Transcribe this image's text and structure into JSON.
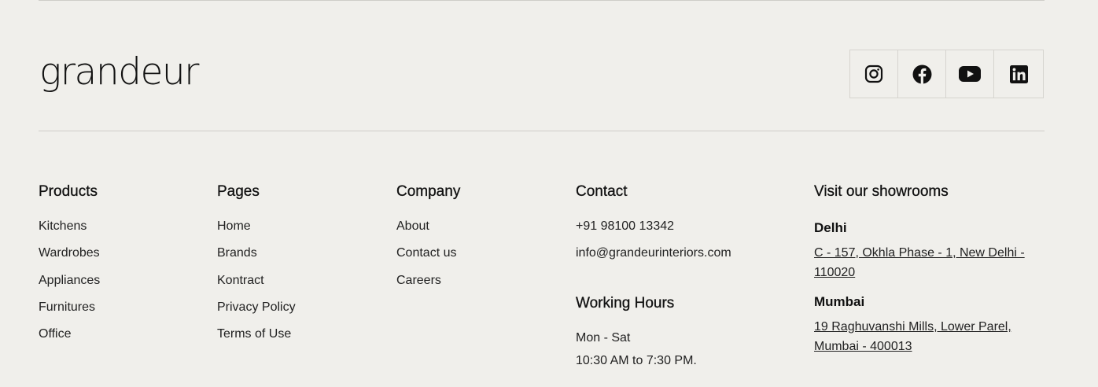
{
  "brand": {
    "logo_text": "grandeur"
  },
  "social": [
    {
      "name": "instagram-icon"
    },
    {
      "name": "facebook-icon"
    },
    {
      "name": "youtube-icon"
    },
    {
      "name": "linkedin-icon"
    }
  ],
  "products": {
    "title": "Products",
    "items": [
      "Kitchens",
      "Wardrobes",
      "Appliances",
      "Furnitures",
      "Office"
    ]
  },
  "pages": {
    "title": "Pages",
    "items": [
      "Home",
      "Brands",
      "Kontract",
      "Privacy Policy",
      "Terms of Use"
    ]
  },
  "company": {
    "title": "Company",
    "items": [
      "About",
      "Contact us",
      "Careers"
    ]
  },
  "contact": {
    "title": "Contact",
    "phone": "+91 98100 13342",
    "email": "info@grandeurinteriors.com",
    "hours_title": "Working Hours",
    "days": "Mon - Sat",
    "hours": "10:30 AM to 7:30 PM."
  },
  "showrooms": {
    "title": "Visit our showrooms",
    "delhi": {
      "city": "Delhi",
      "address": "C - 157, Okhla Phase - 1, New Delhi - 110020"
    },
    "mumbai": {
      "city": "Mumbai",
      "address": "19 Raghuvanshi Mills, Lower Parel, Mumbai - 400013"
    }
  },
  "colors": {
    "background": "#f0efeb",
    "text": "#111111",
    "divider": "#cfcdc8"
  }
}
